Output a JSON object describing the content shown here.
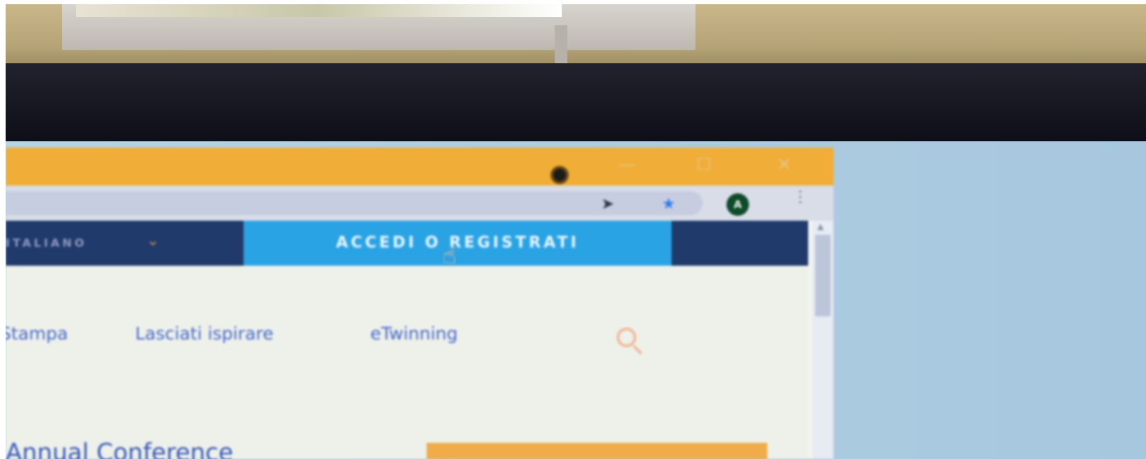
{
  "browser": {
    "window_controls": {
      "minimize": "—",
      "maximize": "☐",
      "close": "✕"
    },
    "toolbar": {
      "send_icon": "send-icon",
      "bookmark_icon": "star-icon",
      "avatar_letter": "A",
      "menu_icon": "more-icon"
    }
  },
  "page": {
    "language_label": "ITALIANO",
    "login_button": "ACCEDI O REGISTRATI",
    "nav_links": [
      "Stampa",
      "Lasciati ispirare",
      "eTwinning"
    ],
    "headline": "Annual Conference"
  },
  "colors": {
    "titlebar": "#f0ad37",
    "header_bg": "#1f3a6b",
    "login_bg": "#2aa3e4",
    "link": "#4768c9",
    "accent_orange": "#f0ac4a"
  }
}
